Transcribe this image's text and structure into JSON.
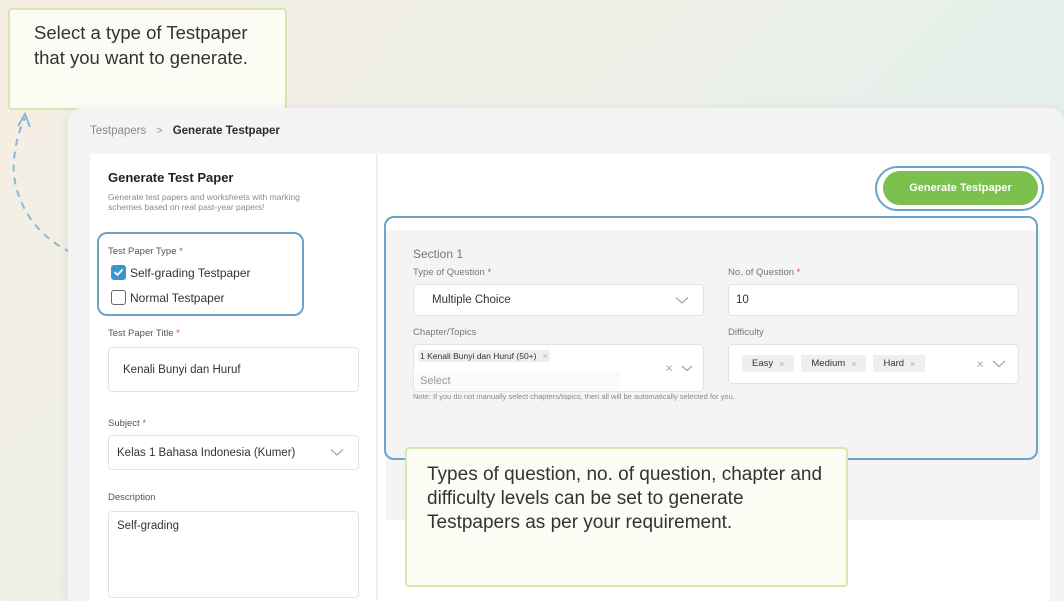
{
  "callouts": {
    "type_hint": "Select a type of Testpaper that you want to generate.",
    "settings_hint": "Types of question, no. of question, chapter and difficulty levels can be set to generate Testpapers as per your requirement."
  },
  "breadcrumb": {
    "parent": "Testpapers",
    "separator": ">",
    "current": "Generate Testpaper"
  },
  "left_panel": {
    "title": "Generate Test Paper",
    "description": "Generate test papers and worksheets with marking schemes based on real past-year papers!",
    "type_label": "Test Paper Type",
    "required_mark": "*",
    "options": [
      {
        "label": "Self-grading Testpaper",
        "checked": true
      },
      {
        "label": "Normal Testpaper",
        "checked": false
      }
    ],
    "title_label": "Test Paper Title",
    "title_value": "Kenali Bunyi dan Huruf",
    "subject_label": "Subject",
    "subject_value": "Kelas 1 Bahasa Indonesia (Kumer)",
    "description_label": "Description",
    "description_value": "Self-grading"
  },
  "right_panel": {
    "generate_button": "Generate Testpaper",
    "section": {
      "title": "Section 1",
      "type_label": "Type of Question",
      "type_value": "Multiple Choice",
      "count_label": "No. of Question",
      "count_value": "10",
      "chapter_label": "Chapter/Topics",
      "chapter_chip": "1 Kenali Bunyi dan Huruf (50+)",
      "chapter_placeholder": "Select",
      "difficulty_label": "Difficulty",
      "difficulty_chips": [
        "Easy",
        "Medium",
        "Hard"
      ],
      "note": "Note: If you do not manually select chapters/topics, then all will be automatically selected for you."
    }
  },
  "colors": {
    "accent_green": "#7cc14d",
    "highlight_blue": "#6ea3c8",
    "checkbox_blue": "#3a94d2",
    "callout_border": "#d6e7b0"
  }
}
